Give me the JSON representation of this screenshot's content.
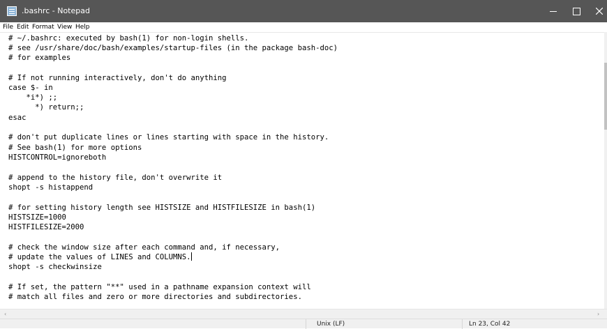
{
  "window": {
    "title": ".bashrc - Notepad",
    "app_icon": "notepad-icon",
    "controls": {
      "minimize": "minimize-icon",
      "maximize": "maximize-icon",
      "close": "close-icon"
    }
  },
  "menu": [
    "File",
    "Edit",
    "Format",
    "View",
    "Help"
  ],
  "editor": {
    "lines": [
      "# ~/.bashrc: executed by bash(1) for non-login shells.",
      "# see /usr/share/doc/bash/examples/startup-files (in the package bash-doc)",
      "# for examples",
      "",
      "# If not running interactively, don't do anything",
      "case $- in",
      "    *i*) ;;",
      "      *) return;;",
      "esac",
      "",
      "# don't put duplicate lines or lines starting with space in the history.",
      "# See bash(1) for more options",
      "HISTCONTROL=ignoreboth",
      "",
      "# append to the history file, don't overwrite it",
      "shopt -s histappend",
      "",
      "# for setting history length see HISTSIZE and HISTFILESIZE in bash(1)",
      "HISTSIZE=1000",
      "HISTFILESIZE=2000",
      "",
      "# check the window size after each command and, if necessary,",
      "# update the values of LINES and COLUMNS.",
      "shopt -s checkwinsize",
      "",
      "# If set, the pattern \"**\" used in a pathname expansion context will",
      "# match all files and zero or more directories and subdirectories."
    ]
  },
  "scrollbar": {
    "left_arrow": "‹",
    "right_arrow": "›"
  },
  "status": {
    "line_ending": "Unix (LF)",
    "position": "Ln 23, Col 42"
  },
  "colors": {
    "titlebar": "#565656",
    "editor_bg": "#ffffff",
    "statusbar": "#f0f0f0"
  }
}
